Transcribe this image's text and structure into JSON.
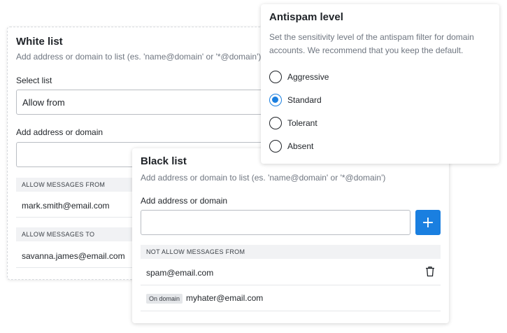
{
  "white_list": {
    "title": "White list",
    "subtitle": "Add address or domain to list (es. 'name@domain' or '*@domain')",
    "select_label": "Select list",
    "select_value": "Allow from",
    "add_label": "Add address or domain",
    "input_value": "",
    "section_from": "ALLOW MESSAGES FROM",
    "from_items": [
      "mark.smith@email.com"
    ],
    "section_to": "ALLOW MESSAGES TO",
    "to_items": [
      "savanna.james@email.com"
    ]
  },
  "antispam": {
    "title": "Antispam level",
    "description": "Set the sensitivity level of the antispam filter for domain accounts. We recommend that you keep the default.",
    "options": [
      {
        "label": "Aggressive",
        "checked": false
      },
      {
        "label": "Standard",
        "checked": true
      },
      {
        "label": "Tolerant",
        "checked": false
      },
      {
        "label": "Absent",
        "checked": false
      }
    ],
    "accent_color": "#1a7fe0"
  },
  "black_list": {
    "title": "Black list",
    "subtitle": "Add address or domain to list (es. 'name@domain' or '*@domain')",
    "add_label": "Add address or domain",
    "input_value": "",
    "add_button": "+",
    "section_from": "NOT ALLOW MESSAGES FROM",
    "items": [
      {
        "text": "spam@email.com",
        "badge": ""
      },
      {
        "text": "myhater@email.com",
        "badge": "On domain"
      }
    ]
  },
  "icons": [
    "plus-icon",
    "trash-icon"
  ]
}
